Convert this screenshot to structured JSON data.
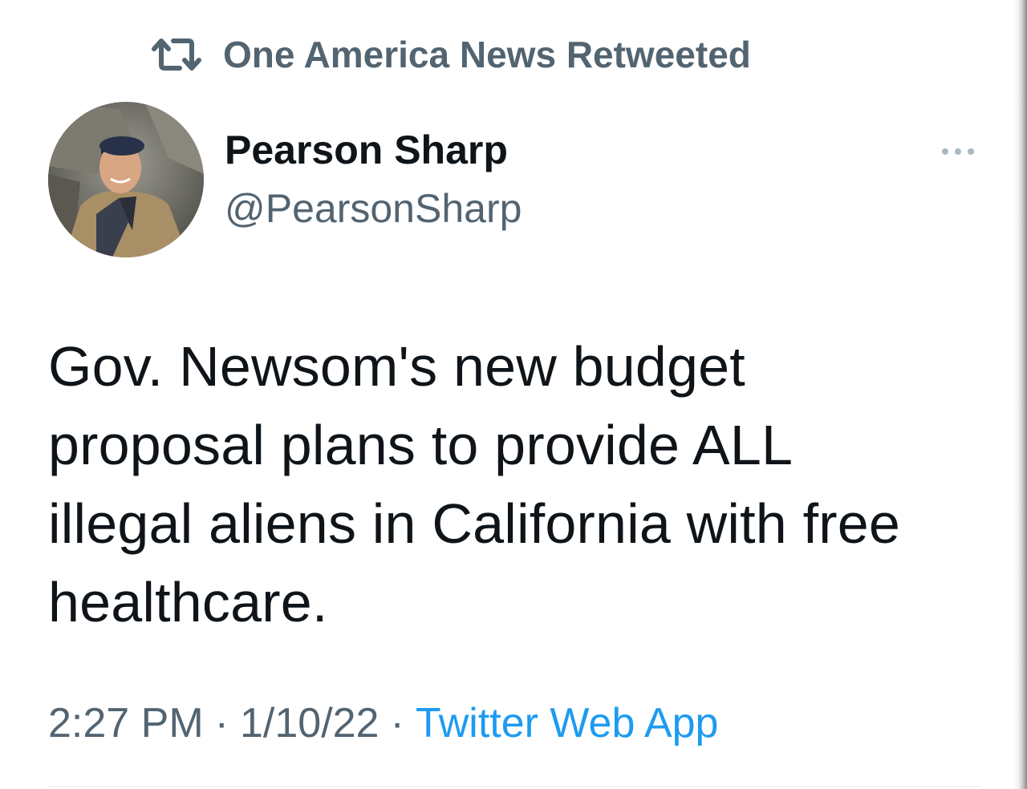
{
  "retweet_context": {
    "icon": "retweet-icon",
    "text": "One America News Retweeted"
  },
  "author": {
    "display_name": "Pearson Sharp",
    "handle": "@PearsonSharp"
  },
  "more_icon": "more-options-icon",
  "tweet": {
    "lines": [
      "Gov. Newsom's new budget",
      "proposal plans to provide ALL",
      "illegal aliens in California with free",
      "healthcare."
    ]
  },
  "meta": {
    "time": "2:27 PM",
    "separator": "·",
    "date": "1/10/22",
    "source": "Twitter Web App"
  },
  "colors": {
    "secondary_text": "#536471",
    "primary_text": "#0f1419",
    "link": "#1d9bf0"
  }
}
